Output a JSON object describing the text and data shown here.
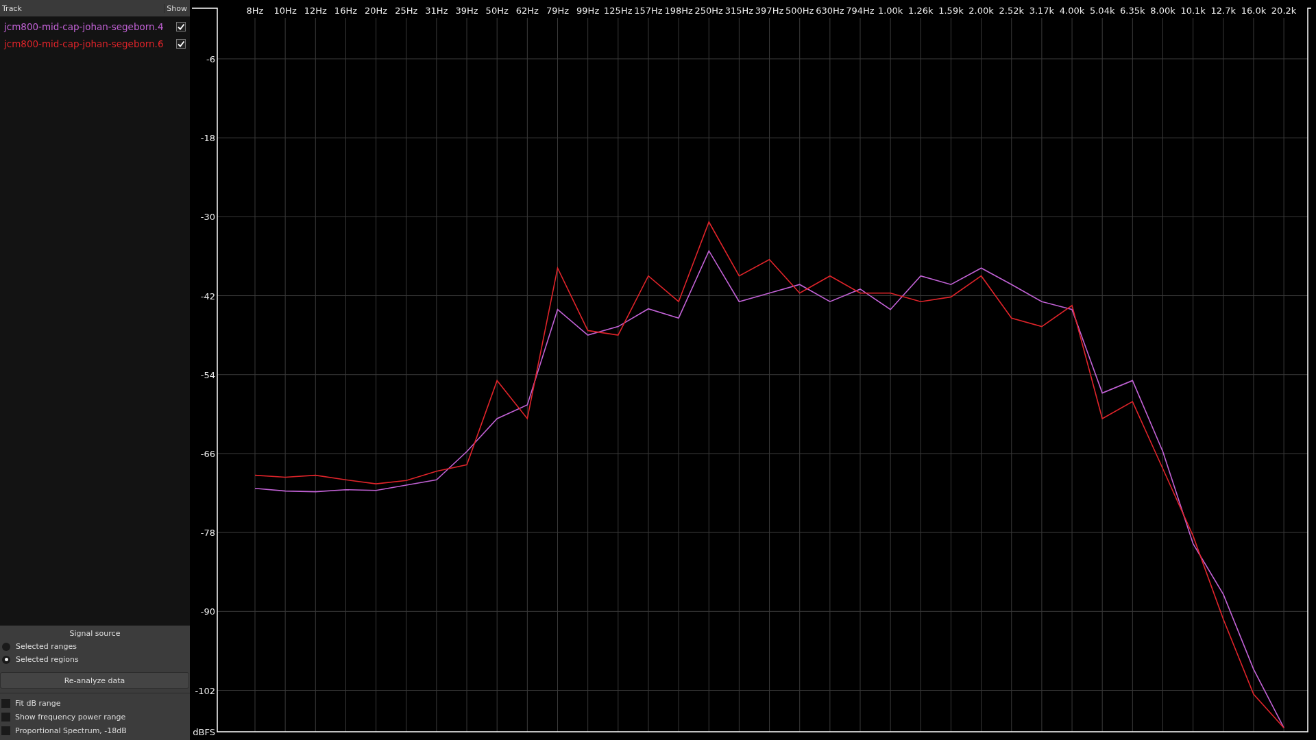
{
  "track_list": {
    "columns": [
      "Track",
      "Show"
    ],
    "tracks": [
      {
        "name": "jcm800-mid-cap-johan-segeborn.4",
        "color": "#c262d6",
        "shown": true
      },
      {
        "name": "jcm800-mid-cap-johan-segeborn.6",
        "color": "#e0242a",
        "shown": true
      }
    ]
  },
  "signal_source": {
    "title": "Signal source",
    "options": [
      {
        "label": "Selected ranges",
        "selected": false
      },
      {
        "label": "Selected regions",
        "selected": true
      }
    ]
  },
  "reanalyze_button": "Re-analyze data",
  "options": [
    {
      "label": "Fit dB range",
      "checked": false
    },
    {
      "label": "Show frequency power range",
      "checked": false
    },
    {
      "label": "Proportional Spectrum, -18dB",
      "checked": false
    }
  ],
  "spectrum": {
    "chart_data": {
      "type": "line",
      "ylabel": "dBFS",
      "grid": true,
      "categories": [
        "8Hz",
        "10Hz",
        "12Hz",
        "16Hz",
        "20Hz",
        "25Hz",
        "31Hz",
        "39Hz",
        "50Hz",
        "62Hz",
        "79Hz",
        "99Hz",
        "125Hz",
        "157Hz",
        "198Hz",
        "250Hz",
        "315Hz",
        "397Hz",
        "500Hz",
        "630Hz",
        "794Hz",
        "1.00k",
        "1.26k",
        "1.59k",
        "2.00k",
        "2.52k",
        "3.17k",
        "4.00k",
        "5.04k",
        "6.35k",
        "8.00k",
        "10.1k",
        "12.7k",
        "16.0k",
        "20.2k"
      ],
      "series": [
        {
          "color": "#c262d6",
          "values": [
            -71.3,
            -71.7,
            -71.8,
            -71.5,
            -71.6,
            -70.8,
            -70,
            -65.7,
            -60.7,
            -58.6,
            -44.1,
            -48,
            -46.7,
            -44,
            -45.4,
            -35.2,
            -42.9,
            -41.6,
            -40.3,
            -42.9,
            -41,
            -44.1,
            -39,
            -40.3,
            -37.8,
            -40.3,
            -42.9,
            -44.1,
            -56.8,
            -54.9,
            -65.7,
            -79.7,
            -87.4,
            -98.8,
            -107.7
          ]
        },
        {
          "color": "#e0242a",
          "values": [
            -69.3,
            -69.6,
            -69.3,
            -70,
            -70.6,
            -70.1,
            -68.7,
            -67.7,
            -54.9,
            -60.7,
            -37.8,
            -47.3,
            -48,
            -39,
            -42.9,
            -30.8,
            -39,
            -36.5,
            -41.6,
            -39,
            -41.6,
            -41.6,
            -42.9,
            -42.2,
            -39,
            -45.4,
            -46.7,
            -43.5,
            -60.7,
            -58.1,
            -68.3,
            -78.5,
            -91.2,
            -102.6,
            -107.7
          ]
        }
      ],
      "ylim": [
        -108.3,
        1.7
      ],
      "yticks": [
        -6,
        -18,
        -30,
        -42,
        -54,
        -66,
        -78,
        -90,
        -102
      ]
    }
  }
}
